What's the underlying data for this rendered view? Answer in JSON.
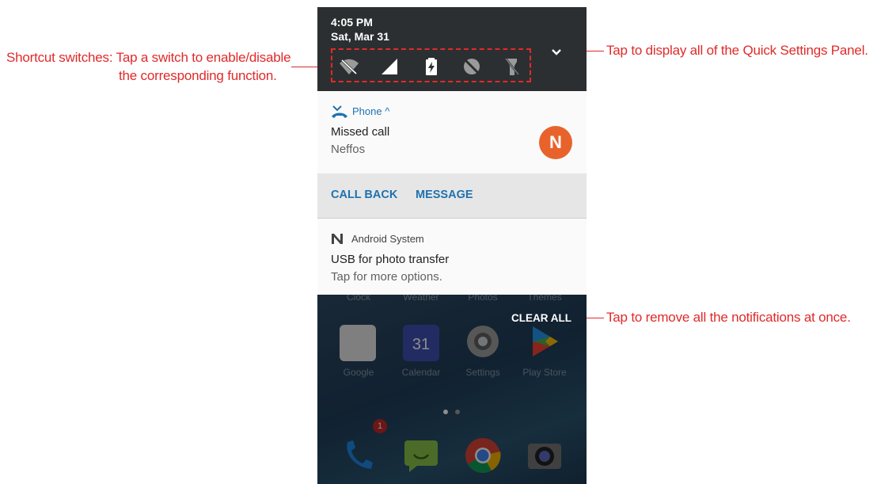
{
  "annotations": {
    "left_line1": "Shortcut switches: Tap a switch to enable/disable",
    "left_line2": "the corresponding function.",
    "right_top": "Tap to display all of the Quick Settings Panel.",
    "right_bottom": "Tap to remove all the notifications at once."
  },
  "status": {
    "time": "4:05 PM",
    "date": "Sat, Mar 31"
  },
  "quick_settings": {
    "switches": [
      "wifi-off-icon",
      "signal-icon",
      "battery-saver-icon",
      "do-not-disturb-icon",
      "flashlight-off-icon"
    ],
    "expand_icon": "chevron-down-icon"
  },
  "notification_missed_call": {
    "app_name": "Phone ^",
    "title": "Missed call",
    "subtitle": "Neffos",
    "avatar_letter": "N",
    "avatar_color": "#e8632b",
    "actions": [
      "CALL BACK",
      "MESSAGE"
    ]
  },
  "notification_usb": {
    "app_name": "Android System",
    "title": "USB for photo transfer",
    "subtitle": "Tap for more options."
  },
  "home_screen": {
    "clear_all": "CLEAR ALL",
    "top_row_labels": [
      "Clock",
      "Weather",
      "Photos",
      "Themes"
    ],
    "apps": [
      "Google",
      "Calendar",
      "Settings",
      "Play Store"
    ],
    "calendar_day": "31",
    "dock_badge": "1"
  },
  "colors": {
    "accent": "#1e72b0",
    "annotation": "#e02a2a",
    "qs_background": "#2c2f31"
  }
}
